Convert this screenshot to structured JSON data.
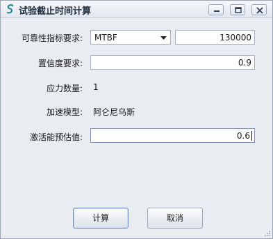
{
  "window": {
    "title": "试验截止时间计算"
  },
  "form": {
    "reliability_label": "可靠性指标要求:",
    "reliability_metric": "MTBF",
    "reliability_value": "130000",
    "confidence_label": "置信度要求:",
    "confidence_value": "0.9",
    "stress_count_label": "应力数量:",
    "stress_count_value": "1",
    "accel_model_label": "加速模型:",
    "accel_model_value": "阿仑尼乌斯",
    "activation_energy_label": "激活能预估值:",
    "activation_energy_value": "0.6"
  },
  "buttons": {
    "calculate": "计算",
    "cancel": "取消"
  },
  "icons": {
    "app": "app-logo-icon",
    "minimize": "minimize-icon",
    "maximize": "maximize-icon",
    "close": "close-icon",
    "dropdown": "chevron-down-icon",
    "resize": "resize-grip-icon"
  },
  "colors": {
    "window_bg": "#e9ecf1",
    "accent": "#2f8a9a"
  }
}
